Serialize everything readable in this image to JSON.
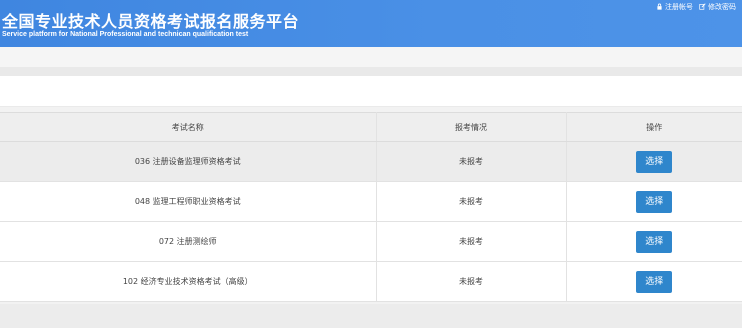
{
  "header": {
    "title": "全国专业技术人员资格考试报名服务平台",
    "subtitle": "Service platform for National Professional and technican qualification test",
    "links": [
      {
        "label": "注册帐号",
        "icon": "lock-icon"
      },
      {
        "label": "修改密码",
        "icon": "edit-icon"
      }
    ],
    "brand_color": "#4a90e6"
  },
  "table": {
    "columns": [
      "考试名称",
      "报考情况",
      "操作"
    ],
    "rows": [
      {
        "name": "036 注册设备监理师资格考试",
        "status": "未报考",
        "action": "选择"
      },
      {
        "name": "048 监理工程师职业资格考试",
        "status": "未报考",
        "action": "选择"
      },
      {
        "name": "072 注册测绘师",
        "status": "未报考",
        "action": "选择"
      },
      {
        "name": "102 经济专业技术资格考试（高级）",
        "status": "未报考",
        "action": "选择"
      }
    ],
    "button_color": "#2f86cc"
  }
}
